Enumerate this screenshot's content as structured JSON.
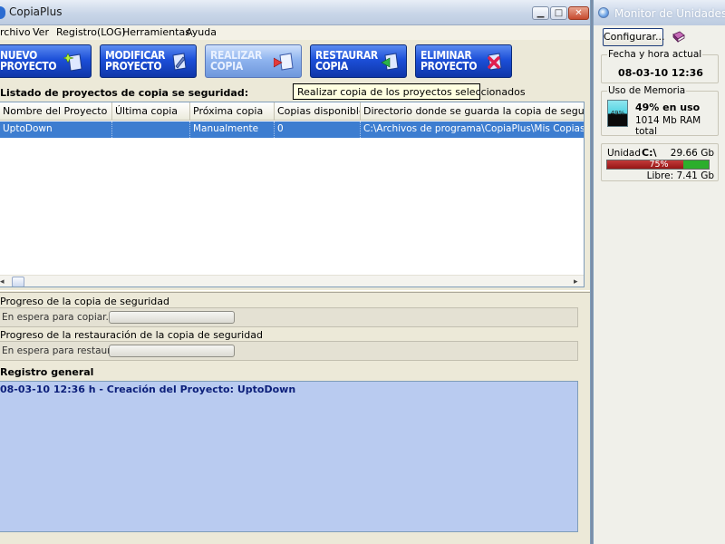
{
  "window": {
    "title": "CopiaPlus",
    "controls": {
      "minimize": "▁",
      "maximize": "□",
      "close": "✕"
    }
  },
  "menu": [
    "rchivo",
    "Ver",
    "Registro(LOG)",
    "Herramientas",
    "Ayuda"
  ],
  "toolbar": {
    "buttons": [
      {
        "label": "NUEVO\nPROYECTO",
        "icon": "sparkle-doc-icon"
      },
      {
        "label": "MODIFICAR\nPROYECTO",
        "icon": "pencil-doc-icon"
      },
      {
        "label": "REALIZAR\nCOPIA",
        "icon": "arrow-right-doc-icon",
        "hovered": true
      },
      {
        "label": "RESTAURAR\nCOPIA",
        "icon": "arrow-left-doc-icon"
      },
      {
        "label": "ELIMINAR\nPROYECTO",
        "icon": "x-doc-icon"
      }
    ]
  },
  "tooltip": "Realizar copia de los proyectos seleccionados",
  "projects": {
    "caption": "Listado de proyectos de copia se seguridad:",
    "columns": [
      "Nombre del Proyecto",
      "Última copia",
      "Próxima copia",
      "Copias disponibles",
      "Directorio donde se guarda la copia de seguridad"
    ],
    "rows": [
      [
        "UptoDown",
        "",
        "Manualmente",
        "0",
        "C:\\Archivos de programa\\CopiaPlus\\Mis Copias de Seg"
      ]
    ],
    "scroll": {
      "left": "◂",
      "right": "▸"
    }
  },
  "backup_progress": {
    "title": "Progreso de la copia de seguridad",
    "status": "En espera para copiar...",
    "progress": 0
  },
  "restore_progress": {
    "title": "Progreso de la restauración de la copia de seguridad",
    "status": "En espera para restaurar...",
    "progress": 0
  },
  "log": {
    "caption": "Registro general",
    "entries": [
      "08-03-10 12:36 h - Creación del Proyecto: UptoDown"
    ]
  },
  "monitor": {
    "title": "Monitor de Unidades",
    "config_label": "Configurar...",
    "datetime": {
      "title": "Fecha y hora actual",
      "value": "08-03-10 12:36"
    },
    "memory": {
      "title": "Uso de Memoria",
      "icon_label": "49%",
      "used": "49% en uso",
      "total": "1014 Mb RAM total",
      "used_fraction": 0.49
    },
    "drive": {
      "label": "Unidad",
      "letter": "C:\\",
      "size": "29.66 Gb",
      "used_pct_label": "75%",
      "used_fraction": 0.75,
      "free": "Libre: 7.41 Gb"
    }
  },
  "colors": {
    "selection": "#3d7dd0",
    "toolbar_button": "#1c4fd8",
    "log_background": "#b9cbf0",
    "drive_used": "#b01f1f",
    "drive_free": "#2cae2c"
  }
}
